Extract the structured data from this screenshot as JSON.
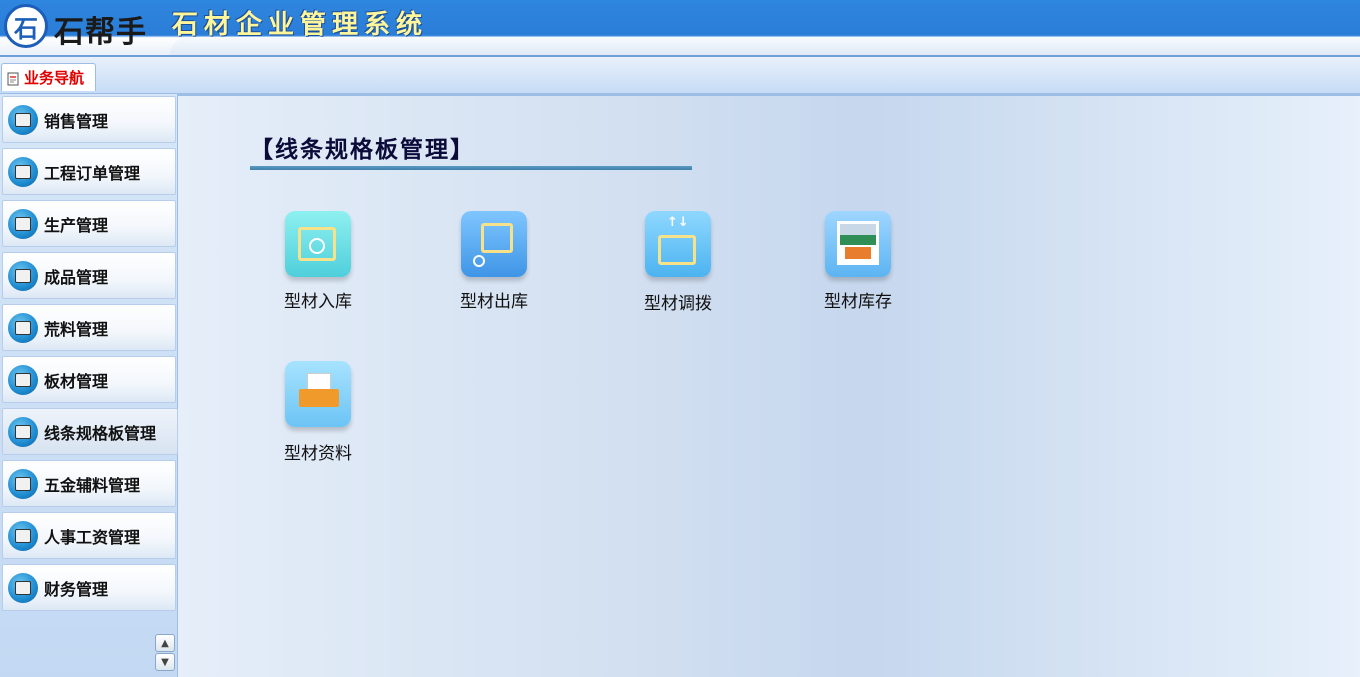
{
  "header": {
    "logo_letter": "石",
    "brand_name": "石帮手",
    "system_title": "石材企业管理系统"
  },
  "tabs": [
    {
      "label": "业务导航",
      "active": true
    }
  ],
  "sidebar": {
    "items": [
      {
        "label": "销售管理"
      },
      {
        "label": "工程订单管理"
      },
      {
        "label": "生产管理"
      },
      {
        "label": "成品管理"
      },
      {
        "label": "荒料管理"
      },
      {
        "label": "板材管理"
      },
      {
        "label": "线条规格板管理",
        "active": true
      },
      {
        "label": "五金辅料管理"
      },
      {
        "label": "人事工资管理"
      },
      {
        "label": "财务管理"
      }
    ],
    "scroll_up_icon": "chevron-up-icon",
    "scroll_down_icon": "chevron-down-icon"
  },
  "main": {
    "title": "【线条规格板管理】",
    "tiles": [
      {
        "label": "型材入库",
        "icon": "warehouse-in-icon"
      },
      {
        "label": "型材出库",
        "icon": "warehouse-out-icon"
      },
      {
        "label": "型材调拨",
        "icon": "transfer-icon"
      },
      {
        "label": "型材库存",
        "icon": "inventory-icon"
      },
      {
        "label": "型材资料",
        "icon": "documents-icon"
      }
    ]
  },
  "colors": {
    "header_blue": "#2a7dd8",
    "title_yellow": "#fff59a",
    "tab_label_red": "#e00000",
    "title_rule": "#4a8ab6"
  }
}
